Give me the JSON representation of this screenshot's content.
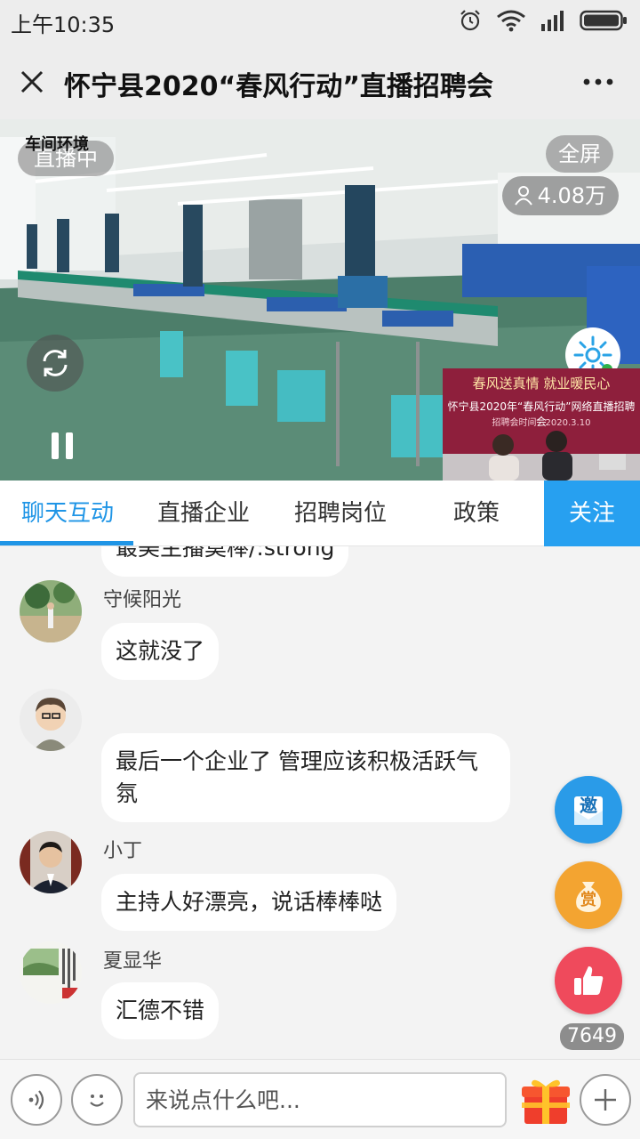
{
  "status_bar": {
    "time": "上午10:35"
  },
  "header": {
    "title": "怀宁县2020“春风行动”直播招聘会"
  },
  "video": {
    "live_label": "直播中",
    "scene_caption": "车间环境",
    "fullscreen_label": "全屏",
    "viewer_count": "4.08万",
    "pip": {
      "slogan": "春风送真情 就业暖民心",
      "event_title": "怀宁县2020年“春风行动”网络直播招聘会",
      "event_date": "招聘会时间：2020.3.10"
    }
  },
  "tabs": {
    "items": [
      {
        "label": "聊天互动",
        "active": true
      },
      {
        "label": "直播企业",
        "active": false
      },
      {
        "label": "招聘岗位",
        "active": false
      },
      {
        "label": "政策",
        "active": false
      }
    ],
    "follow_label": "关注"
  },
  "chat": {
    "partial_message": "最美主播莫棒/:strong",
    "messages": [
      {
        "user": "守候阳光",
        "text": "这就没了"
      },
      {
        "user": "",
        "text": "最后一个企业了 管理应该积极活跃气氛"
      },
      {
        "user": "小丁",
        "text": "主持人好漂亮，说话棒棒哒"
      },
      {
        "user": "夏显华",
        "text": "汇德不错"
      }
    ]
  },
  "floating": {
    "invite_label": "邀",
    "reward_label": "赏",
    "like_count": "7649"
  },
  "input": {
    "placeholder": "来说点什么吧..."
  },
  "colors": {
    "accent": "#1f95e6",
    "follow_bg": "#27a0f0",
    "like": "#ef4a5c",
    "reward": "#f3a431"
  }
}
